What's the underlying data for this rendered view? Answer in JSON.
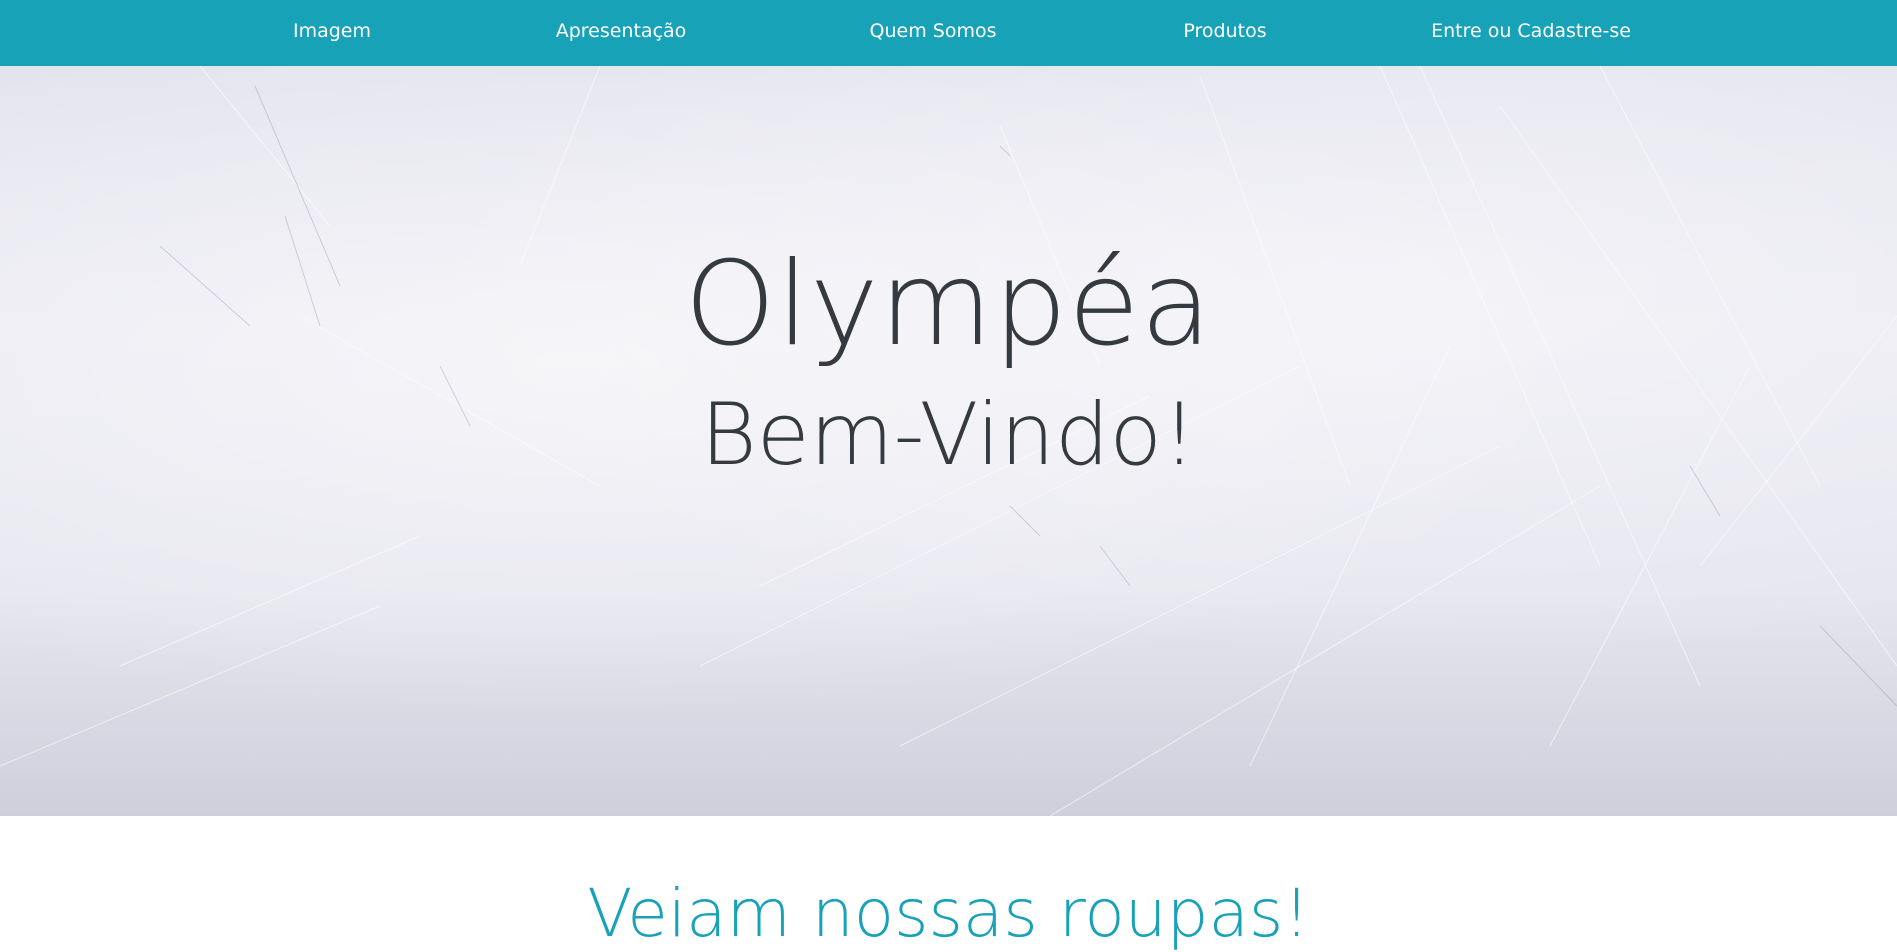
{
  "nav": {
    "items": [
      {
        "label": "Imagem"
      },
      {
        "label": "Apresentação"
      },
      {
        "label": "Quem Somos"
      },
      {
        "label": "Produtos"
      },
      {
        "label": "Entre ou Cadastre-se"
      }
    ]
  },
  "hero": {
    "title": "Olympéa",
    "subtitle": "Bem-Vindo!"
  },
  "section": {
    "heading": "Veiam nossas roupas!"
  },
  "colors": {
    "accent": "#17a2b8",
    "text_dark": "#343a40",
    "nav_text": "#ffffff"
  }
}
